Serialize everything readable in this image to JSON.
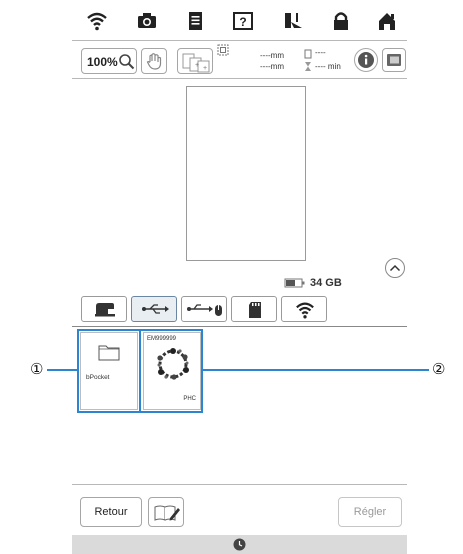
{
  "toolbar": {
    "zoom_label": "100%",
    "dim_width": "----mm",
    "dim_height": "----mm",
    "stitch_count": "----",
    "time_label": "---- min"
  },
  "storage": {
    "capacity": "34 GB"
  },
  "files": [
    {
      "name": "bPocket",
      "kind": "folder"
    },
    {
      "name": "EM999999",
      "format": "PHC",
      "kind": "embroidery"
    }
  ],
  "callouts": {
    "one": "①",
    "two": "②"
  },
  "bottom": {
    "back_label": "Retour",
    "set_label": "Régler"
  },
  "colors": {
    "accent": "#2b86cf",
    "status_bar": "#dadada"
  },
  "icons": [
    "wifi-icon",
    "camera-icon",
    "document-icon",
    "help-icon",
    "sewing-needle-icon",
    "lock-icon",
    "home-icon",
    "zoom-icon",
    "hand-pan-icon",
    "fit-icon",
    "info-icon",
    "screen-icon",
    "expand-up-icon",
    "battery-icon",
    "machine-tab-icon",
    "usb-tab-icon",
    "usb-mouse-tab-icon",
    "sd-card-tab-icon",
    "wifi-tab-icon",
    "folder-icon",
    "edit-icon",
    "clock-icon"
  ]
}
